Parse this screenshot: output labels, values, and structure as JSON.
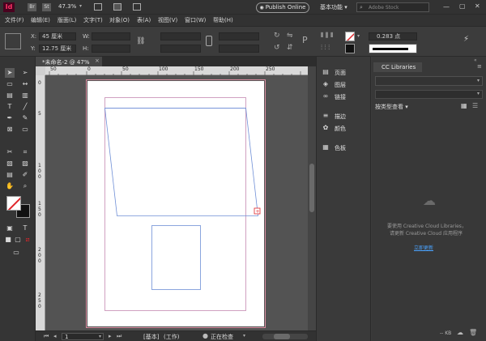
{
  "titlebar": {
    "app_logo": "Id",
    "bridge": "Br",
    "stock": "St",
    "zoom": "47.3%",
    "publish": "Publish Online",
    "workspace": "基本功能",
    "search_placeholder": "Adobe Stock"
  },
  "menu": [
    "文件(F)",
    "编辑(E)",
    "版面(L)",
    "文字(T)",
    "对象(O)",
    "表(A)",
    "视图(V)",
    "窗口(W)",
    "帮助(H)"
  ],
  "controls": {
    "x_label": "X:",
    "x_value": "45 厘米",
    "y_label": "Y:",
    "y_value": "12.75 厘米",
    "w_label": "W:",
    "h_label": "H:",
    "stroke_weight": "0.283 点"
  },
  "document": {
    "tab_title": "*未命名-2 @ 47%",
    "ruler_labels": [
      "50",
      "0",
      "50",
      "100",
      "150",
      "200",
      "250"
    ],
    "ruler_v_labels": [
      "0",
      "5",
      "1",
      "0",
      "0",
      "1",
      "5",
      "0",
      "2",
      "0",
      "0",
      "2",
      "5",
      "0"
    ]
  },
  "status": {
    "page": "1",
    "master": "[基本]",
    "workflow": "(工作)",
    "preflight": "正在检查"
  },
  "panels": [
    {
      "icon": "pages-icon",
      "label": "页面"
    },
    {
      "icon": "layers-icon",
      "label": "图层"
    },
    {
      "icon": "links-icon",
      "label": "链接"
    },
    {
      "icon": "stroke-icon",
      "label": "描边"
    },
    {
      "icon": "color-icon",
      "label": "颜色"
    },
    {
      "icon": "swatches-icon",
      "label": "色板"
    }
  ],
  "cc_libraries": {
    "tab": "CC Libraries",
    "view_by": "按类型查看",
    "message_line1": "要使用 Creative Cloud Libraries，",
    "message_line2": "请更新 Creative Cloud 应用程序",
    "update_link": "立即更新",
    "footer_size": "-- KB"
  },
  "colors": {
    "accent": "#ff3366",
    "frame_blue": "#6f8fd6",
    "margin_magenta": "#c58ab2"
  }
}
